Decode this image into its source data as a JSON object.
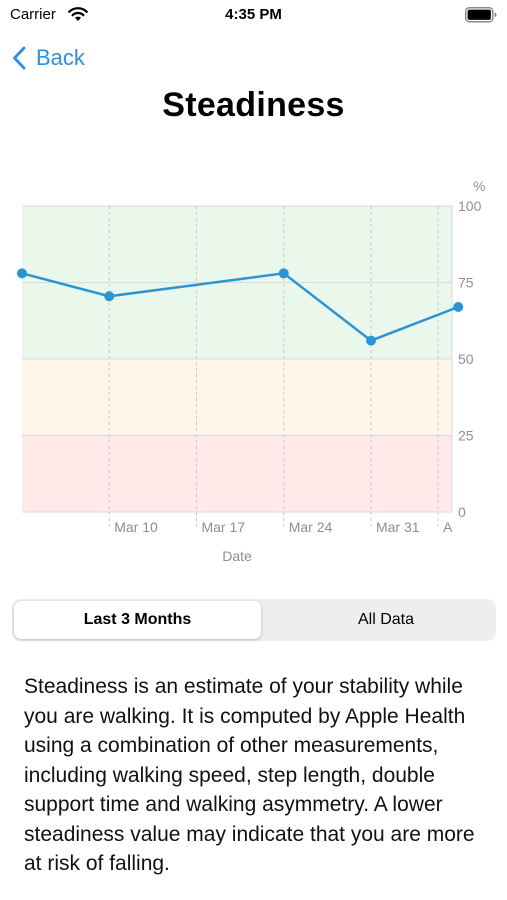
{
  "status_bar": {
    "carrier": "Carrier",
    "time": "4:35 PM",
    "wifi_icon": "wifi-icon",
    "battery_icon": "battery-full-icon"
  },
  "nav": {
    "back_label": "Back",
    "back_icon": "chevron-left-icon",
    "accent_color": "#2f8ee0"
  },
  "page": {
    "title": "Steadiness"
  },
  "chart_data": {
    "type": "line",
    "y_unit": "%",
    "xlabel": "Date",
    "ylabel": "",
    "ylim": [
      0,
      100
    ],
    "y_ticks": [
      "100",
      "75",
      "50",
      "25",
      "0"
    ],
    "x_tick_labels": [
      "Mar 10",
      "Mar 17",
      "Mar 24",
      "Mar 31",
      "A"
    ],
    "series": [
      {
        "points": [
          {
            "x": "Mar 3",
            "y": 78
          },
          {
            "x": "Mar 10",
            "y": 70.5
          },
          {
            "x": "Mar 24",
            "y": 78
          },
          {
            "x": "Mar 31",
            "y": 56
          },
          {
            "x": "Apr 7",
            "y": 67
          }
        ]
      }
    ],
    "bands": [
      {
        "from": 50,
        "to": 100,
        "color": "#eaf8ec"
      },
      {
        "from": 25,
        "to": 50,
        "color": "#fff6e9"
      },
      {
        "from": 0,
        "to": 25,
        "color": "#ffe9e9"
      }
    ],
    "line_color": "#2b95d4",
    "grid": true
  },
  "segmented_control": {
    "options": [
      "Last 3 Months",
      "All Data"
    ],
    "selected": "Last 3 Months"
  },
  "description": "Steadiness is an estimate of your stability while you are walking. It is computed by Apple Health using a combination of other measurements, including walking speed, step length, double support time and walking asymmetry. A lower steadiness value may indicate that you are more at risk of falling."
}
